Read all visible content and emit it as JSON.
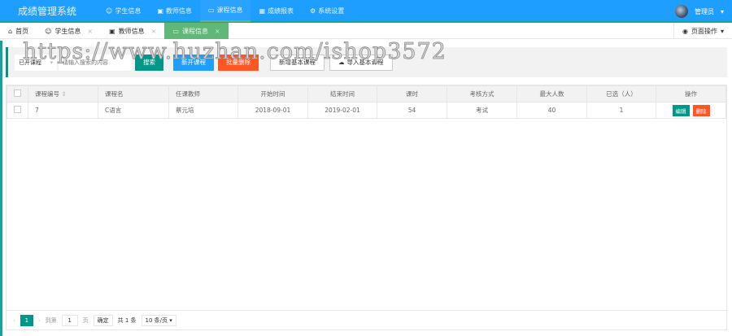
{
  "header": {
    "title": "成绩管理系统",
    "nav": [
      {
        "label": "学生信息",
        "icon": "users-icon"
      },
      {
        "label": "教师信息",
        "icon": "id-card-icon"
      },
      {
        "label": "课程信息",
        "icon": "book-icon",
        "active": true
      },
      {
        "label": "成绩报表",
        "icon": "table-icon"
      },
      {
        "label": "系统设置",
        "icon": "gear-icon"
      }
    ],
    "user": "管理员"
  },
  "tabs": {
    "items": [
      {
        "label": "首页"
      },
      {
        "label": "学生信息"
      },
      {
        "label": "教师信息"
      },
      {
        "label": "课程信息",
        "active": true
      }
    ],
    "page_op": "页面操作"
  },
  "toolbar": {
    "select": "已开课程",
    "search_placeholder": "请输入搜索的内容",
    "search": "搜索",
    "open": "新开课程",
    "batch_delete": "批量删除",
    "add_basic": "新增基本课程",
    "import_basic": "导入基本课程"
  },
  "table": {
    "headers": [
      "课程编号",
      "课程名",
      "任课教师",
      "开始时间",
      "结束时间",
      "课时",
      "考核方式",
      "最大人数",
      "已选（人）",
      "操作"
    ],
    "rows": [
      {
        "id": "7",
        "name": "C语言",
        "teacher": "蔡元培",
        "start": "2018-09-01",
        "end": "2019-02-01",
        "hours": "54",
        "exam": "考试",
        "max": "40",
        "selected": "1"
      }
    ],
    "edit": "编辑",
    "delete": "删除"
  },
  "pager": {
    "current": "1",
    "goto": "到第",
    "page_value": "1",
    "page_unit": "页",
    "confirm": "确定",
    "total": "共 1 条",
    "per_page": "10 条/页"
  },
  "colors": {
    "header": "#1E9FFF",
    "accent": "#009688",
    "danger": "#FF5722",
    "tab_active": "#5FB878"
  },
  "watermark": "https://www.huzhan.com/ishop3572"
}
